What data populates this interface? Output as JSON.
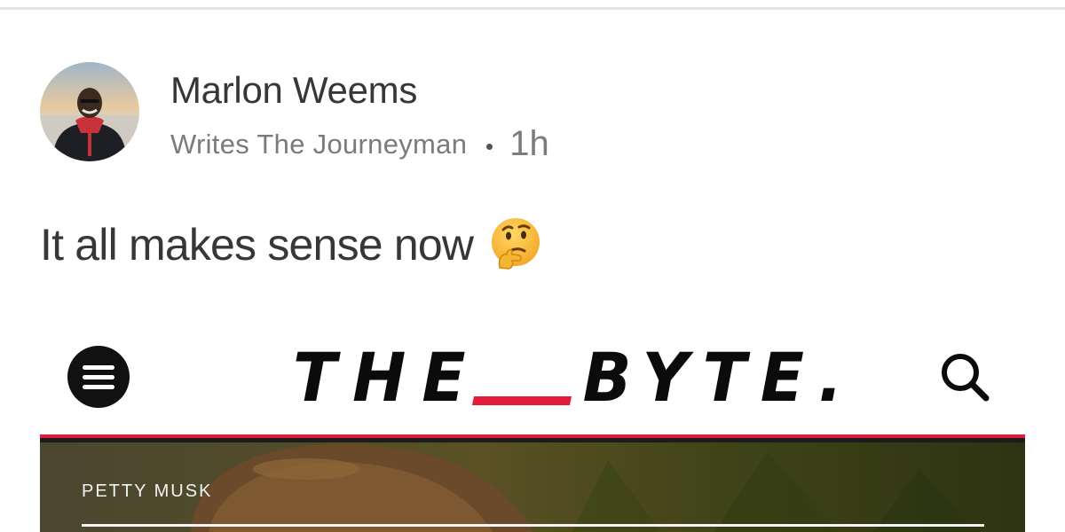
{
  "post": {
    "author_name": "Marlon Weems",
    "publication": "Writes The Journeyman",
    "timestamp": "1h",
    "text": "It all makes sense now",
    "emoji": "thinking-face-icon"
  },
  "embed": {
    "brand_part1": "THE",
    "brand_part2": "BYTE.",
    "category": "PETTY MUSK",
    "accent_color": "#e31b3a",
    "icons": [
      "hamburger-menu-icon",
      "search-icon"
    ]
  }
}
